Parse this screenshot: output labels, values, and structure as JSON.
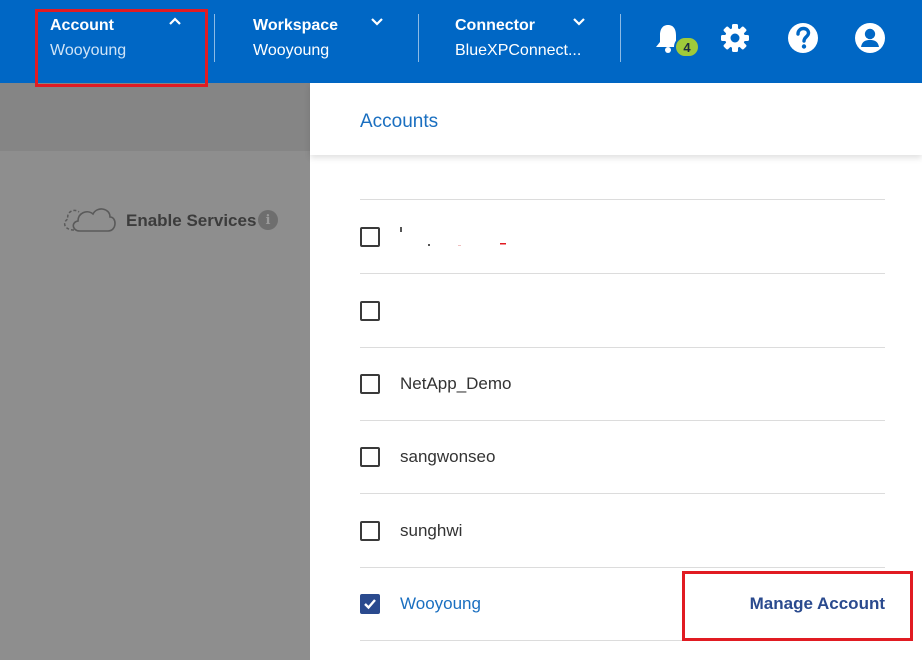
{
  "topbar": {
    "account": {
      "title": "Account",
      "value": "Wooyoung"
    },
    "workspace": {
      "title": "Workspace",
      "value": "Wooyoung"
    },
    "connector": {
      "title": "Connector",
      "value": "BlueXPConnect..."
    },
    "notifications": {
      "count": "4",
      "icon": "bell-icon"
    },
    "settings_icon": "gear-icon",
    "help_icon": "help-icon",
    "user_icon": "user-icon"
  },
  "left": {
    "enable_services": "Enable Services",
    "info_glyph": "i"
  },
  "accounts_panel": {
    "title": "Accounts",
    "rows": [
      {
        "label": "",
        "checked": false
      },
      {
        "label": "",
        "checked": false
      },
      {
        "label": "NetApp_Demo",
        "checked": false
      },
      {
        "label": "sangwonseo",
        "checked": false
      },
      {
        "label": "sunghwi",
        "checked": false
      },
      {
        "label": "Wooyoung",
        "checked": true
      }
    ],
    "manage_label": "Manage Account"
  },
  "colors": {
    "topbar": "#0067c5",
    "highlight": "#e11b22",
    "link": "#1a6fc0",
    "checked": "#2a4a8e",
    "badge": "#9fca3a"
  }
}
